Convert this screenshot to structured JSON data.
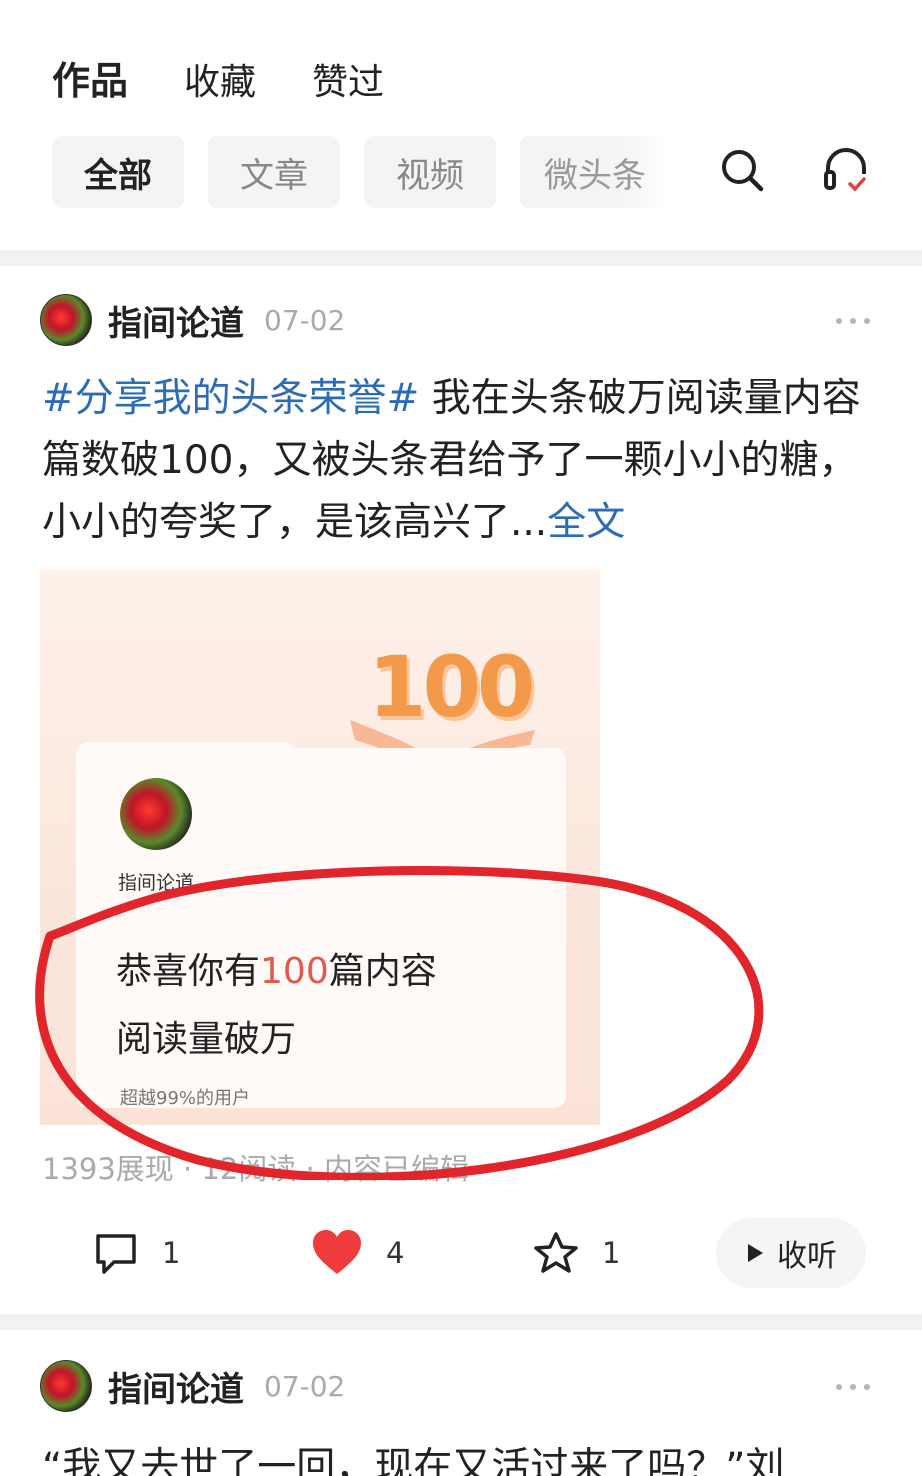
{
  "top_tabs": [
    "作品",
    "收藏",
    "赞过"
  ],
  "filters": [
    "全部",
    "文章",
    "视频",
    "微头条"
  ],
  "icons": {
    "search": "search-icon",
    "listen": "headphones-icon"
  },
  "post1": {
    "author": "指间论道",
    "date": "07-02",
    "hashtag": "#分享我的头条荣誉#",
    "text": " 我在头条破万阅读量内容篇数破100，又被头条君给予了一颗小小的糖，小小的夸奖了，是该高兴了...",
    "read_more": "全文",
    "card": {
      "badge": "100",
      "author": "指间论道",
      "line1_prefix": "恭喜你有",
      "line1_num": "100",
      "line1_suffix": "篇内容",
      "line2": "阅读量破万",
      "sub": "超越99%的用户"
    },
    "stats": "1393展现 · 12阅读 · 内容已编辑",
    "comments": "1",
    "likes": "4",
    "favorites": "1",
    "listen_label": "收听"
  },
  "post2": {
    "author": "指间论道",
    "date": "07-02",
    "text": "“我又去世了一回，现在又活过来了吗？”刘"
  },
  "colors": {
    "link": "#2c6bb5",
    "like": "#ef3b3b",
    "annotation": "#e2242b"
  }
}
